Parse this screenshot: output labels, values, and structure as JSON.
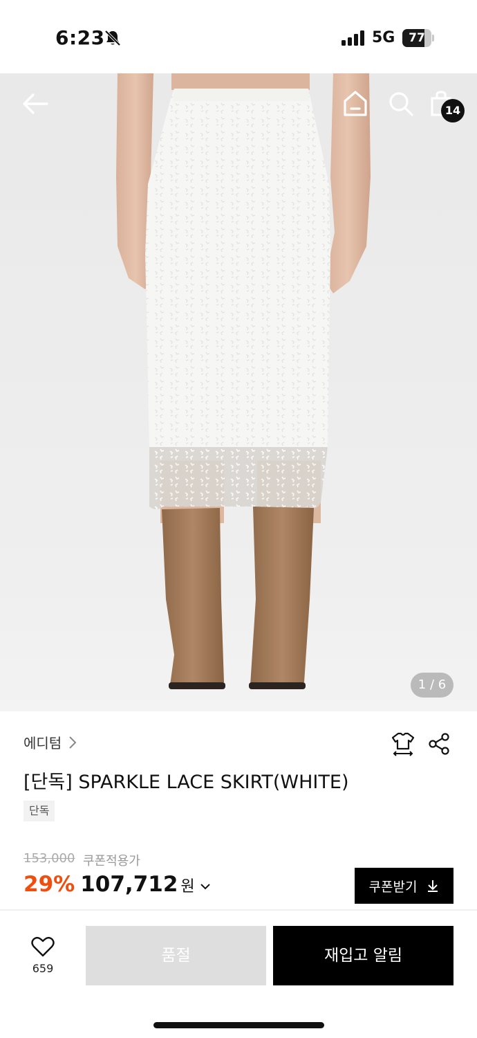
{
  "status_bar": {
    "time": "6:23",
    "network": "5G",
    "battery_percent": "77",
    "battery_level": 0.77,
    "icons": [
      "bell-off-icon",
      "signal-icon",
      "battery-icon"
    ]
  },
  "header": {
    "icons": [
      "back-arrow-icon",
      "home-icon",
      "search-icon",
      "shopping-bag-icon"
    ],
    "cart_count": "14"
  },
  "gallery": {
    "page_indicator": "1 / 6",
    "current": 1,
    "total": 6
  },
  "product": {
    "brand": "에디텀",
    "title": "[단독] SPARKLE LACE SKIRT(WHITE)",
    "tag": "단독",
    "original_price": "153,000",
    "coupon_label": "쿠폰적용가",
    "discount": "29%",
    "final_price": "107,712",
    "currency": "원",
    "icons": [
      "size-guide-icon",
      "share-icon",
      "chevron-right-icon",
      "chevron-down-icon"
    ]
  },
  "coupon": {
    "label": "쿠폰받기",
    "icon": "download-icon"
  },
  "bottom_bar": {
    "like_count": "659",
    "soldout_label": "품절",
    "restock_label": "재입고 알림",
    "icons": [
      "heart-icon"
    ]
  },
  "colors": {
    "discount": "#f04e0f",
    "primary_button": "#000000",
    "disabled_button": "#dedede"
  }
}
